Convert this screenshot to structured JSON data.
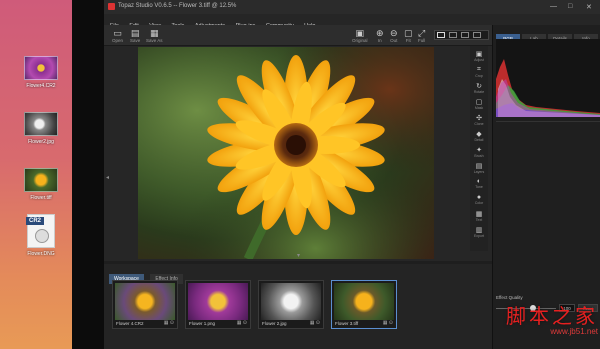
{
  "desktop": {
    "icons": [
      {
        "label": "Flower4.CR2",
        "kind": "image-purple"
      },
      {
        "label": "Flower2.jpg",
        "kind": "image-bw"
      },
      {
        "label": "Flower.tiff",
        "kind": "image-color"
      },
      {
        "label": "Flower.DNG",
        "kind": "raw-file",
        "badge": "CR2"
      }
    ]
  },
  "window": {
    "title": "Topaz Studio V0.6.5 -- Flower 3.tiff @ 12.5%",
    "controls": {
      "minimize": "—",
      "maximize": "□",
      "close": "✕"
    }
  },
  "menu": [
    "File",
    "Edit",
    "View",
    "Tools",
    "Adjustments",
    "Plug-ins",
    "Community",
    "Help"
  ],
  "toolbar": {
    "left": [
      {
        "label": "Open",
        "icon": "folder-icon"
      },
      {
        "label": "Save",
        "icon": "save-icon"
      },
      {
        "label": "Save As",
        "icon": "save-as-icon"
      }
    ],
    "right": [
      {
        "label": "Original",
        "icon": "image-icon"
      },
      {
        "label": "In",
        "icon": "zoom-in-icon"
      },
      {
        "label": "Out",
        "icon": "zoom-out-icon"
      },
      {
        "label": "Fit",
        "icon": "fit-icon"
      },
      {
        "label": "Full",
        "icon": "fullscreen-icon"
      }
    ]
  },
  "side_tools": [
    {
      "label": "Adjust",
      "icon": "camera-icon"
    },
    {
      "label": "Crop",
      "icon": "crop-icon"
    },
    {
      "label": "Rotate",
      "icon": "rotate-icon"
    },
    {
      "label": "Mask",
      "icon": "mask-icon"
    },
    {
      "label": "Clone",
      "icon": "clone-icon"
    },
    {
      "label": "Detail",
      "icon": "detail-icon"
    },
    {
      "label": "Brush",
      "icon": "brush-icon"
    },
    {
      "label": "Layers",
      "icon": "layers-icon"
    },
    {
      "label": "Tone",
      "icon": "tone-icon"
    },
    {
      "label": "Color",
      "icon": "color-icon"
    },
    {
      "label": "Text",
      "icon": "text-icon"
    },
    {
      "label": "Export",
      "icon": "export-icon"
    }
  ],
  "bottom_tabs": [
    {
      "label": "Workspace",
      "active": true
    },
    {
      "label": "Effect Info",
      "active": false
    }
  ],
  "filmstrip": [
    {
      "name": "Flower 4.CR2",
      "selected": false,
      "tint": "purple-green"
    },
    {
      "name": "Flower 1.png",
      "selected": false,
      "tint": "purple"
    },
    {
      "name": "Flower 2.jpg",
      "selected": false,
      "tint": "bw"
    },
    {
      "name": "Flower 3.tiff",
      "selected": true,
      "tint": "green"
    }
  ],
  "right_panel": {
    "tabs": [
      {
        "label": "RGB",
        "active": true
      },
      {
        "label": "Lab",
        "active": false
      },
      {
        "label": "Details",
        "active": false
      },
      {
        "label": "Info",
        "active": false
      }
    ],
    "effect_quality_label": "Effect Quality",
    "effect_quality_value": "100",
    "effect_quality_fraction": 0.62,
    "reset_label": "Reset"
  },
  "watermark": {
    "text": "脚本之家",
    "url": "www.jb51.net"
  }
}
